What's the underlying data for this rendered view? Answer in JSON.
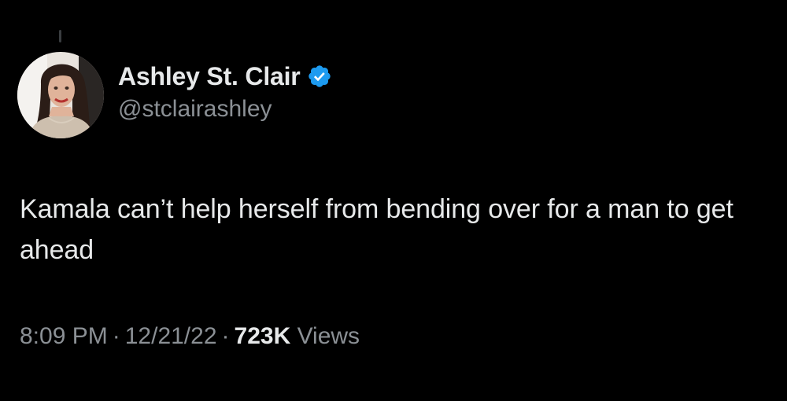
{
  "user": {
    "display_name": "Ashley St. Clair",
    "handle": "@stclairashley",
    "verified": true,
    "verified_badge_color": "#1d9bf0"
  },
  "tweet": {
    "text": "Kamala can’t help herself from bending over for a man to get ahead",
    "time": "8:09 PM",
    "date": "12/21/22",
    "separator": "·",
    "views_count": "723K",
    "views_label": "Views"
  },
  "icons": {
    "verified": "verified-badge-icon",
    "avatar": "profile-photo"
  },
  "colors": {
    "background": "#000000",
    "primary_text": "#e7e9ea",
    "secondary_text": "#8b9095"
  }
}
